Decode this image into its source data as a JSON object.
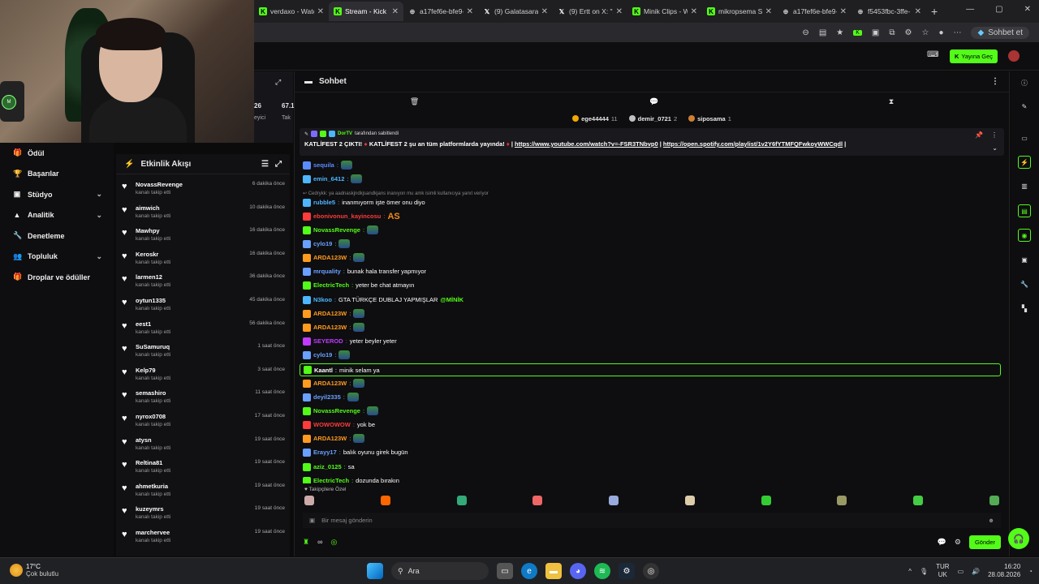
{
  "browser": {
    "tabs": [
      {
        "label": "verdaxo - Watc",
        "icon": "kick-icon",
        "color": "#53fc18"
      },
      {
        "label": "Stream - Kick D",
        "icon": "kick-icon",
        "color": "#53fc18",
        "active": true
      },
      {
        "label": "a17fef6e-bfe9-",
        "icon": "globe-icon",
        "color": "#cccccc"
      },
      {
        "label": "(9) Galatasaray",
        "icon": "x-icon",
        "color": "#ffffff"
      },
      {
        "label": "(9) Ertt on X: \"s",
        "icon": "x-icon",
        "color": "#ffffff"
      },
      {
        "label": "Minik Clips - W",
        "icon": "kick-icon",
        "color": "#53fc18"
      },
      {
        "label": "mikropsema St",
        "icon": "kick-icon",
        "color": "#53fc18"
      },
      {
        "label": "a17fef6e-bfe9-",
        "icon": "globe-icon",
        "color": "#cccccc"
      },
      {
        "label": "f5453fbc-3ffe-",
        "icon": "globe-icon",
        "color": "#cccccc"
      }
    ],
    "profile_label": "Sohbet et"
  },
  "topbar": {
    "goto_label": "Yayına Geç"
  },
  "stats": {
    "a": "26",
    "b": "67.1",
    "c": "eyici",
    "d": "Tak"
  },
  "nav": {
    "items": [
      {
        "label": "Ödül",
        "icon": "gift-icon",
        "chev": false
      },
      {
        "label": "Başarılar",
        "icon": "trophy-icon",
        "chev": false
      },
      {
        "label": "Stüdyo",
        "icon": "studio-icon",
        "chev": true
      },
      {
        "label": "Analitik",
        "icon": "chart-icon",
        "chev": true
      },
      {
        "label": "Denetleme",
        "icon": "wrench-icon",
        "chev": false
      },
      {
        "label": "Topluluk",
        "icon": "people-icon",
        "chev": true
      },
      {
        "label": "Droplar ve ödüller",
        "icon": "drop-icon",
        "chev": false
      }
    ]
  },
  "activity": {
    "title": "Etkinlik Akışı",
    "items": [
      {
        "name": "NovassRevenge",
        "sub": "kanalı takip etti",
        "ago": "6 dakika önce"
      },
      {
        "name": "aimwich",
        "sub": "kanalı takip etti",
        "ago": "10 dakika önce"
      },
      {
        "name": "Mawhpy",
        "sub": "kanalı takip etti",
        "ago": "16 dakika önce"
      },
      {
        "name": "Keroskr",
        "sub": "kanalı takip etti",
        "ago": "16 dakika önce"
      },
      {
        "name": "larmen12",
        "sub": "kanalı takip etti",
        "ago": "36 dakika önce"
      },
      {
        "name": "oytun1335",
        "sub": "kanalı takip etti",
        "ago": "45 dakika önce"
      },
      {
        "name": "eest1",
        "sub": "kanalı takip etti",
        "ago": "56 dakika önce"
      },
      {
        "name": "SuSamuruq",
        "sub": "kanalı takip etti",
        "ago": "1 saat önce"
      },
      {
        "name": "Kelp79",
        "sub": "kanalı takip etti",
        "ago": "3 saat önce"
      },
      {
        "name": "semashiro",
        "sub": "kanalı takip etti",
        "ago": "11 saat önce"
      },
      {
        "name": "nyrox0708",
        "sub": "kanalı takip etti",
        "ago": "17 saat önce"
      },
      {
        "name": "atysn",
        "sub": "kanalı takip etti",
        "ago": "19 saat önce"
      },
      {
        "name": "Reltina81",
        "sub": "kanalı takip etti",
        "ago": "19 saat önce"
      },
      {
        "name": "ahmetkuria",
        "sub": "kanalı takip etti",
        "ago": "19 saat önce"
      },
      {
        "name": "kuzeymrs",
        "sub": "kanalı takip etti",
        "ago": "19 saat önce"
      },
      {
        "name": "marchervee",
        "sub": "kanalı takip etti",
        "ago": "19 saat önce"
      }
    ]
  },
  "chat": {
    "title": "Sohbet",
    "leaders": [
      {
        "name": "ege44444",
        "count": "11",
        "color": "#f2a900"
      },
      {
        "name": "demir_0721",
        "count": "2",
        "color": "#c0c0c0"
      },
      {
        "name": "siposama",
        "count": "1",
        "color": "#cd7f32"
      }
    ],
    "pinned": {
      "by_user": "DorTV",
      "by_suffix": "tarafından sabitlendi",
      "text": "KATLİFEST 2 ÇIKTI!",
      "text2": "KATLİFEST 2 şu an tüm platformlarda yayında!",
      "link1": "https://www.youtube.com/watch?v=-FSR3TNbvp0",
      "link2": "https://open.spotify.com/playlist/1v2Y6fYTMFQFwkoyWWCqdl"
    },
    "messages": [
      {
        "user": "sequila",
        "text": "",
        "color": "#5b8cff",
        "emote": true
      },
      {
        "user": "emin_6412",
        "text": "",
        "color": "#4db6ff",
        "emote": true
      },
      {
        "user": "",
        "text": "↩ Cedrykk: ya aadnaskjndkjsandkjans inanıyon mu amk isimli kullanıcıya yanıt veriyor",
        "color": "#888888",
        "reply": true
      },
      {
        "user": "rubble5",
        "text": "inanmıyorm işte ömer onu diyo",
        "color": "#4db6ff"
      },
      {
        "user": "ebonivonun_kayincosu",
        "text": "AS",
        "color": "#ff3b3b",
        "emote": false
      },
      {
        "user": "NovassRevenge",
        "text": "",
        "color": "#53fc18",
        "emote": true
      },
      {
        "user": "cylo19",
        "text": "",
        "color": "#6aa0ff",
        "emote": true
      },
      {
        "user": "ARDA123W",
        "text": "",
        "color": "#ff9a1f",
        "emote": true
      },
      {
        "user": "mrquality",
        "text": "bunak hala transfer yapmıyor",
        "color": "#6aa0ff"
      },
      {
        "user": "ElectricTech",
        "text": "yeter be chat atmayın",
        "color": "#53fc18"
      },
      {
        "user": "N3koo",
        "text": "GTA TÜRKÇE DUBLAJ YAPMIŞLAR",
        "color": "#4db6ff",
        "mention": "@MİNİK"
      },
      {
        "user": "ARDA123W",
        "text": "",
        "color": "#ff9a1f",
        "emote": true
      },
      {
        "user": "ARDA123W",
        "text": "",
        "color": "#ff9a1f",
        "emote": true
      },
      {
        "user": "SEYEROD",
        "text": "yeter beyler yeter",
        "color": "#c03bff"
      },
      {
        "user": "cylo19",
        "text": "",
        "color": "#6aa0ff",
        "emote": true
      },
      {
        "user": "Kaantl",
        "text": "minik selam ya",
        "color": "#ffffff",
        "hl": true
      },
      {
        "user": "ARDA123W",
        "text": "",
        "color": "#ff9a1f",
        "emote": true
      },
      {
        "user": "deyil2335",
        "text": "",
        "color": "#6aa0ff",
        "emote": true
      },
      {
        "user": "NovassRevenge",
        "text": "",
        "color": "#53fc18",
        "emote": true
      },
      {
        "user": "WOWOWOW",
        "text": "yok be",
        "color": "#ff3b3b"
      },
      {
        "user": "ARDA123W",
        "text": "",
        "color": "#ff9a1f",
        "emote": true
      },
      {
        "user": "Erayy17",
        "text": "balık oyunu girek bugün",
        "color": "#6aa0ff"
      },
      {
        "user": "aziz_0125",
        "text": "sa",
        "color": "#53fc18"
      },
      {
        "user": "ElectricTech",
        "text": "dozunda bırakın",
        "color": "#53fc18"
      }
    ],
    "emote_label": "♥ Takipçilere Özel",
    "input_placeholder": "Bir mesaj gönderin",
    "send_label": "Gönder"
  },
  "taskbar": {
    "temp": "17°C",
    "weather": "Çok bulutlu",
    "search_label": "Ara",
    "lang1": "TUR",
    "lang2": "UK",
    "time": "16:20",
    "date": "28.08.2026",
    "notif_count": "1"
  }
}
